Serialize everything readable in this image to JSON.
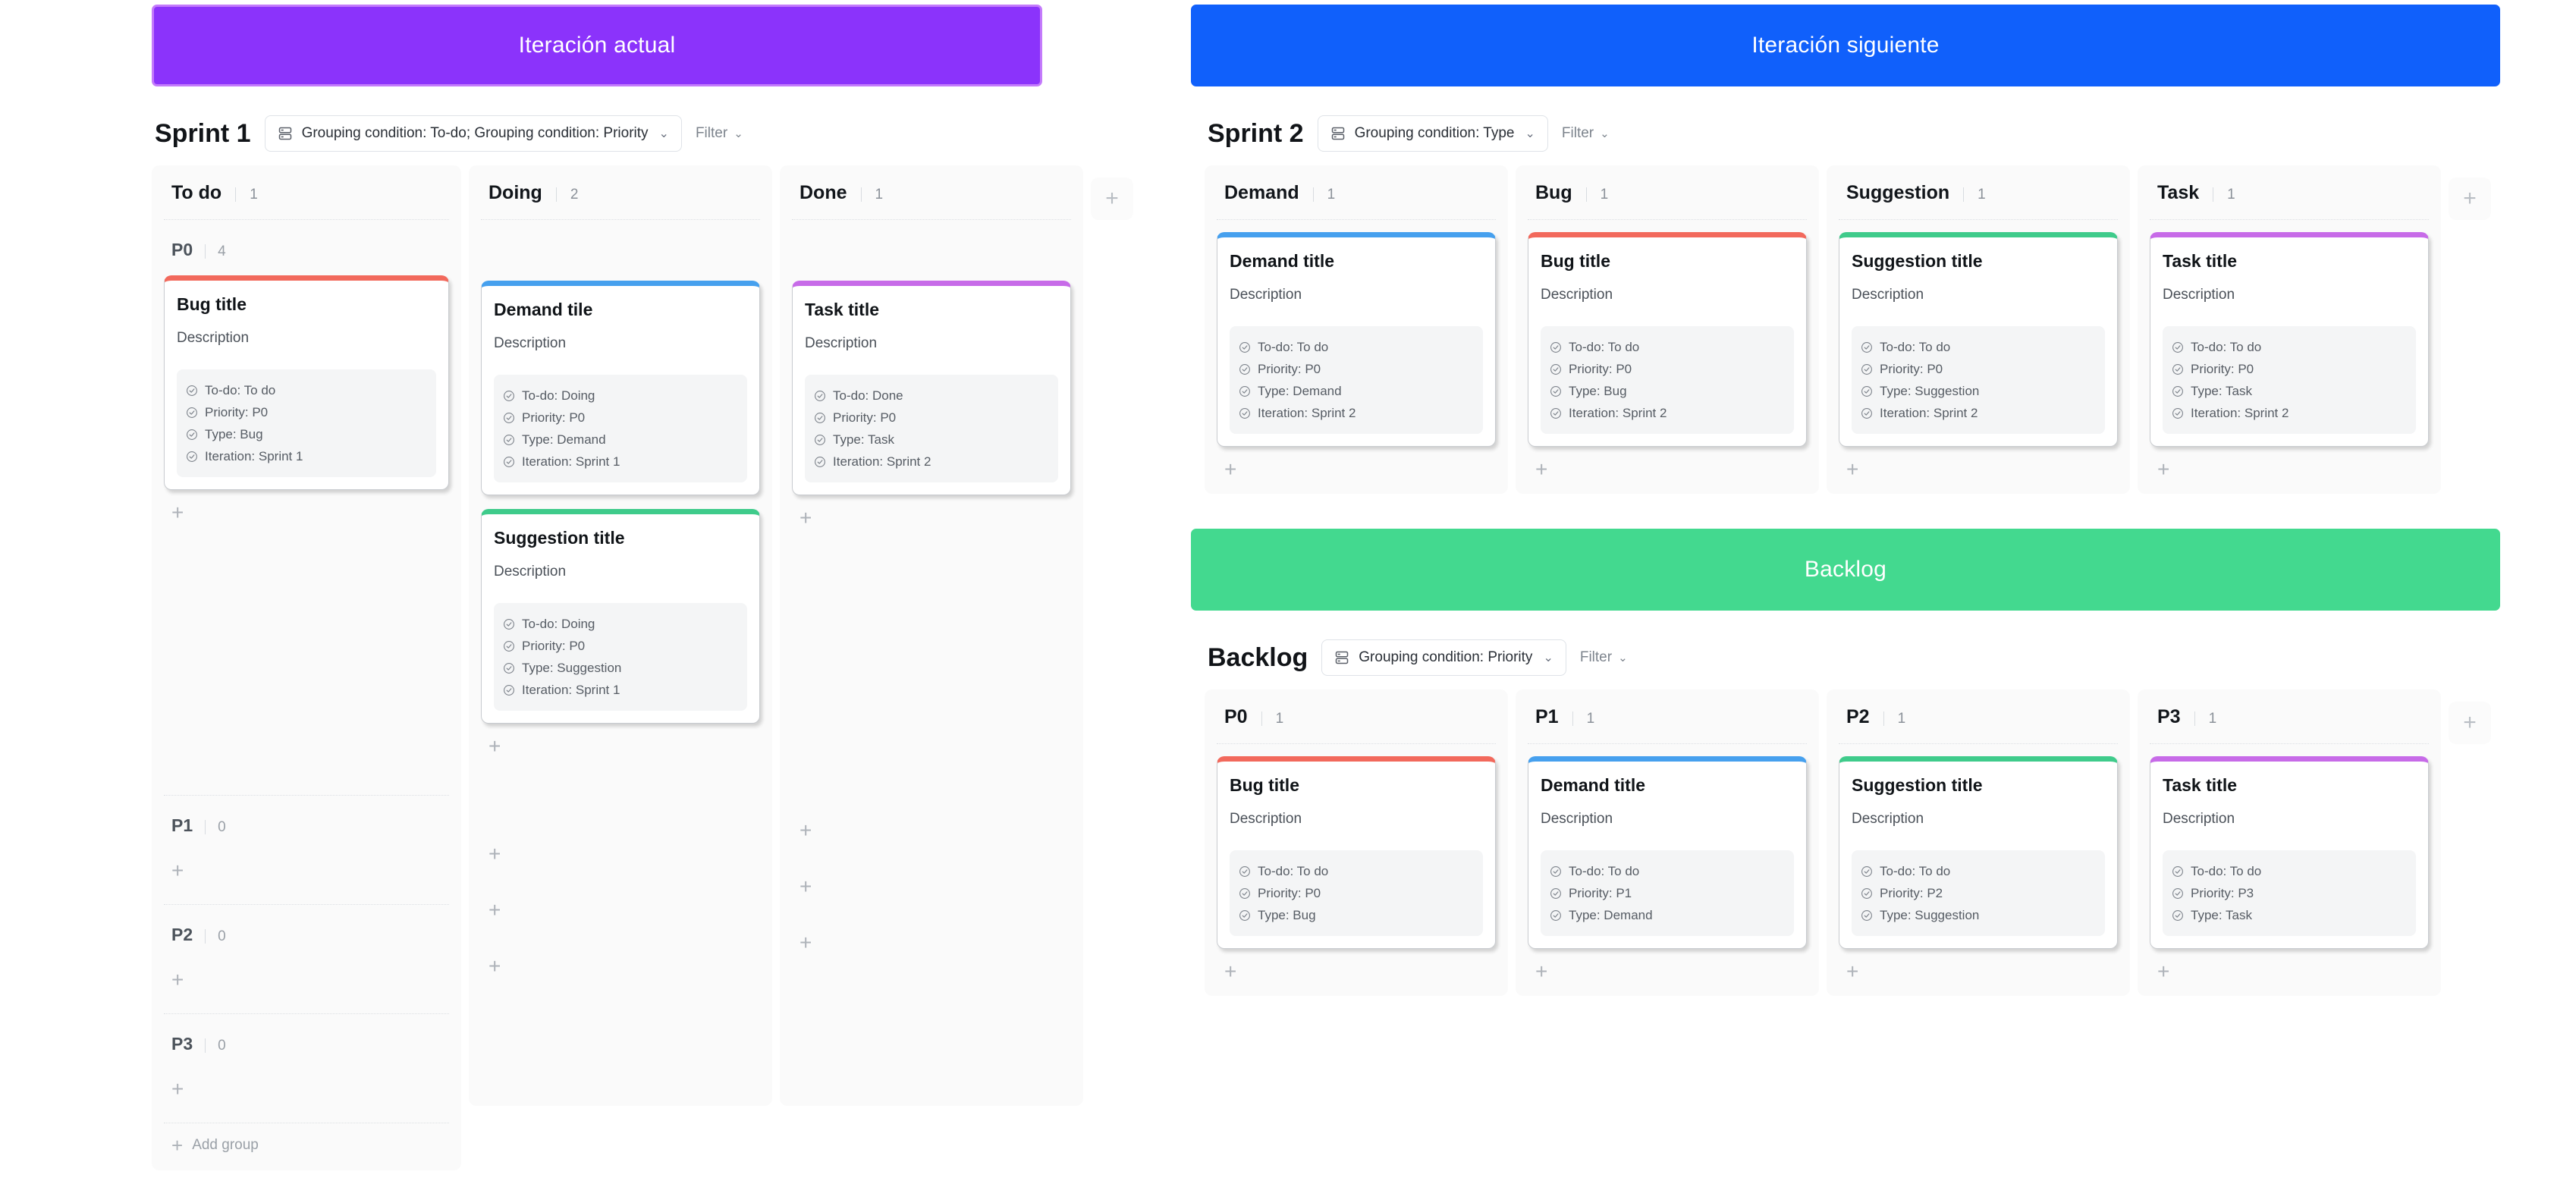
{
  "colors": {
    "banner_current": "#8B33FB",
    "banner_next": "#1060FB",
    "banner_backlog": "#43D98F",
    "card_bug": "#F2695C",
    "card_demand": "#46A0EE",
    "card_suggestion": "#3FCB8B",
    "card_task": "#C76BE8"
  },
  "icons": {
    "grouping": "grouping-rows-icon",
    "caret": "chevron-down-icon",
    "check": "check-circle-icon",
    "plus": "plus-icon"
  },
  "common": {
    "description": "Description",
    "filter_label": "Filter",
    "caret_glyph": "⌄",
    "plus_glyph": "+",
    "add_group_label": "Add group"
  },
  "sections": {
    "current_iteration": {
      "banner": "Iteración actual",
      "toolbar": {
        "title": "Sprint 1",
        "grouping": "Grouping condition: To-do; Grouping condition: Priority",
        "filter": "Filter"
      },
      "columns": [
        {
          "title": "To do",
          "count": "1",
          "groups": [
            {
              "title": "P0",
              "count": "4",
              "cards": [
                {
                  "title": "Bug title",
                  "desc": "Description",
                  "accent": "#F2695C",
                  "meta": [
                    "To-do: To do",
                    "Priority: P0",
                    "Type: Bug",
                    "Iteration: Sprint 1"
                  ]
                }
              ]
            },
            {
              "title": "P1",
              "count": "0",
              "cards": []
            },
            {
              "title": "P2",
              "count": "0",
              "cards": []
            },
            {
              "title": "P3",
              "count": "0",
              "cards": []
            }
          ],
          "has_add_group": true
        },
        {
          "title": "Doing",
          "count": "2",
          "groups": [
            {
              "title": "",
              "count": "",
              "cards": [
                {
                  "title": "Demand tile",
                  "desc": "Description",
                  "accent": "#46A0EE",
                  "meta": [
                    "To-do: Doing",
                    "Priority: P0",
                    "Type: Demand",
                    "Iteration: Sprint 1"
                  ]
                },
                {
                  "title": "Suggestion title",
                  "desc": "Description",
                  "accent": "#3FCB8B",
                  "meta": [
                    "To-do: Doing",
                    "Priority: P0",
                    "Type: Suggestion",
                    "Iteration: Sprint 1"
                  ]
                }
              ]
            }
          ],
          "has_add_group": false
        },
        {
          "title": "Done",
          "count": "1",
          "groups": [
            {
              "title": "",
              "count": "",
              "cards": [
                {
                  "title": "Task title",
                  "desc": "Description",
                  "accent": "#C76BE8",
                  "meta": [
                    "To-do: Done",
                    "Priority: P0",
                    "Type: Task",
                    "Iteration: Sprint 2"
                  ]
                }
              ]
            }
          ],
          "has_add_group": false
        }
      ]
    },
    "next_iteration": {
      "banner": "Iteración siguiente",
      "toolbar": {
        "title": "Sprint 2",
        "grouping": "Grouping condition: Type",
        "filter": "Filter"
      },
      "columns": [
        {
          "title": "Demand",
          "count": "1",
          "cards": [
            {
              "title": "Demand title",
              "desc": "Description",
              "accent": "#46A0EE",
              "meta": [
                "To-do: To do",
                "Priority: P0",
                "Type: Demand",
                "Iteration: Sprint 2"
              ]
            }
          ]
        },
        {
          "title": "Bug",
          "count": "1",
          "cards": [
            {
              "title": "Bug title",
              "desc": "Description",
              "accent": "#F2695C",
              "meta": [
                "To-do: To do",
                "Priority: P0",
                "Type: Bug",
                "Iteration: Sprint 2"
              ]
            }
          ]
        },
        {
          "title": "Suggestion",
          "count": "1",
          "cards": [
            {
              "title": "Suggestion title",
              "desc": "Description",
              "accent": "#3FCB8B",
              "meta": [
                "To-do: To do",
                "Priority: P0",
                "Type: Suggestion",
                "Iteration: Sprint 2"
              ]
            }
          ]
        },
        {
          "title": "Task",
          "count": "1",
          "cards": [
            {
              "title": "Task title",
              "desc": "Description",
              "accent": "#C76BE8",
              "meta": [
                "To-do: To do",
                "Priority: P0",
                "Type: Task",
                "Iteration: Sprint 2"
              ]
            }
          ]
        }
      ]
    },
    "backlog": {
      "banner": "Backlog",
      "toolbar": {
        "title": "Backlog",
        "grouping": "Grouping condition: Priority",
        "filter": "Filter"
      },
      "columns": [
        {
          "title": "P0",
          "count": "1",
          "cards": [
            {
              "title": "Bug title",
              "desc": "Description",
              "accent": "#F2695C",
              "meta": [
                "To-do: To do",
                "Priority: P0",
                "Type: Bug"
              ]
            }
          ]
        },
        {
          "title": "P1",
          "count": "1",
          "cards": [
            {
              "title": "Demand title",
              "desc": "Description",
              "accent": "#46A0EE",
              "meta": [
                "To-do: To do",
                "Priority: P1",
                "Type: Demand"
              ]
            }
          ]
        },
        {
          "title": "P2",
          "count": "1",
          "cards": [
            {
              "title": "Suggestion title",
              "desc": "Description",
              "accent": "#3FCB8B",
              "meta": [
                "To-do: To do",
                "Priority: P2",
                "Type: Suggestion"
              ]
            }
          ]
        },
        {
          "title": "P3",
          "count": "1",
          "cards": [
            {
              "title": "Task title",
              "desc": "Description",
              "accent": "#C76BE8",
              "meta": [
                "To-do: To do",
                "Priority: P3",
                "Type: Task"
              ]
            }
          ]
        }
      ]
    }
  }
}
